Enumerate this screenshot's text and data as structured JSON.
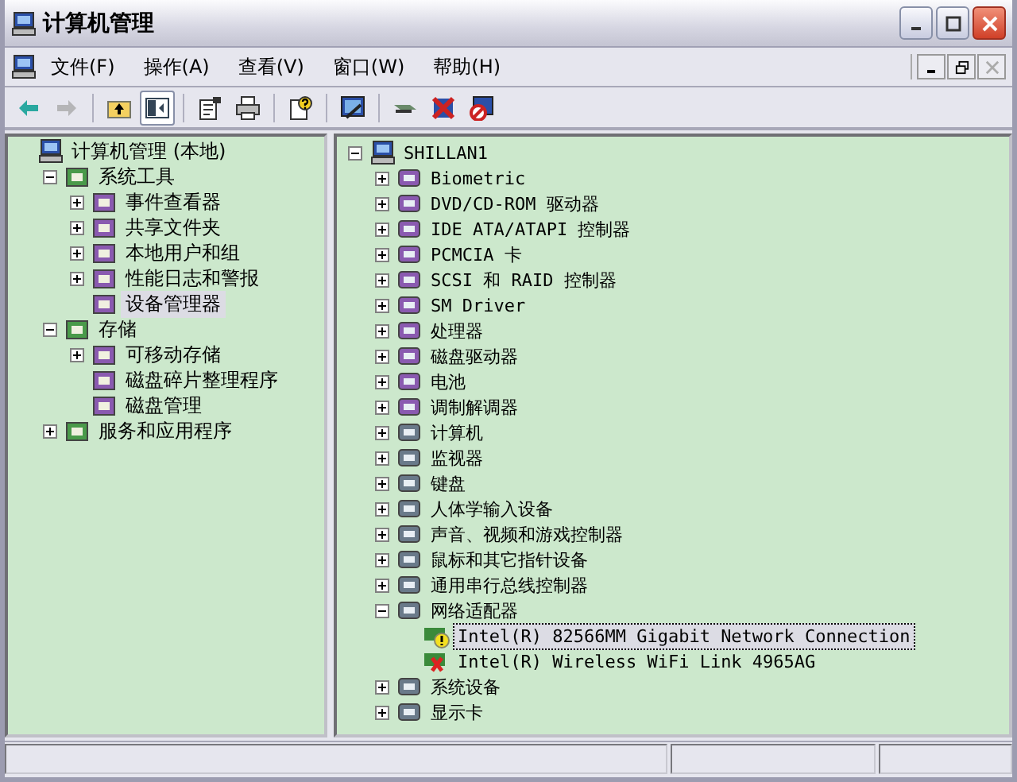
{
  "window": {
    "title": "计算机管理"
  },
  "menu": [
    "文件(F)",
    "操作(A)",
    "查看(V)",
    "窗口(W)",
    "帮助(H)"
  ],
  "toolbar": [
    {
      "kind": "back",
      "disabled": false,
      "pressed": false
    },
    {
      "kind": "forward",
      "disabled": true,
      "pressed": false
    },
    {
      "kind": "sep"
    },
    {
      "kind": "up",
      "disabled": false,
      "pressed": false
    },
    {
      "kind": "tree",
      "disabled": false,
      "pressed": true
    },
    {
      "kind": "sep"
    },
    {
      "kind": "properties",
      "disabled": false,
      "pressed": false
    },
    {
      "kind": "print",
      "disabled": false,
      "pressed": false
    },
    {
      "kind": "sep"
    },
    {
      "kind": "help",
      "disabled": false,
      "pressed": false
    },
    {
      "kind": "sep"
    },
    {
      "kind": "scan",
      "disabled": false,
      "pressed": false
    },
    {
      "kind": "sep"
    },
    {
      "kind": "update",
      "disabled": false,
      "pressed": false
    },
    {
      "kind": "uninstall",
      "disabled": false,
      "pressed": false
    },
    {
      "kind": "disable",
      "disabled": false,
      "pressed": false
    }
  ],
  "left_tree": [
    {
      "label": "计算机管理 (本地)",
      "selected": false,
      "children": [
        {
          "label": "系统工具",
          "has_expander": true,
          "expanded": true,
          "selected": false,
          "children": [
            {
              "label": "事件查看器",
              "has_expander": true,
              "expanded": false,
              "selected": false
            },
            {
              "label": "共享文件夹",
              "has_expander": true,
              "expanded": false,
              "selected": false
            },
            {
              "label": "本地用户和组",
              "has_expander": true,
              "expanded": false,
              "selected": false
            },
            {
              "label": "性能日志和警报",
              "has_expander": true,
              "expanded": false,
              "selected": false
            },
            {
              "label": "设备管理器",
              "has_expander": false,
              "expanded": false,
              "selected": true
            }
          ]
        },
        {
          "label": "存储",
          "has_expander": true,
          "expanded": true,
          "selected": false,
          "children": [
            {
              "label": "可移动存储",
              "has_expander": true,
              "expanded": false,
              "selected": false
            },
            {
              "label": "磁盘碎片整理程序",
              "has_expander": false,
              "expanded": false,
              "selected": false
            },
            {
              "label": "磁盘管理",
              "has_expander": false,
              "expanded": false,
              "selected": false
            }
          ]
        },
        {
          "label": "服务和应用程序",
          "has_expander": true,
          "expanded": false,
          "selected": false
        }
      ]
    }
  ],
  "right_tree": [
    {
      "label": "SHILLAN1",
      "has_expander": true,
      "expanded": true,
      "selected": false,
      "children": [
        {
          "label": "Biometric",
          "has_expander": true,
          "expanded": false,
          "selected": false
        },
        {
          "label": "DVD/CD-ROM 驱动器",
          "has_expander": true,
          "expanded": false,
          "selected": false
        },
        {
          "label": "IDE ATA/ATAPI 控制器",
          "has_expander": true,
          "expanded": false,
          "selected": false
        },
        {
          "label": "PCMCIA 卡",
          "has_expander": true,
          "expanded": false,
          "selected": false
        },
        {
          "label": "SCSI 和 RAID 控制器",
          "has_expander": true,
          "expanded": false,
          "selected": false
        },
        {
          "label": "SM Driver",
          "has_expander": true,
          "expanded": false,
          "selected": false
        },
        {
          "label": "处理器",
          "has_expander": true,
          "expanded": false,
          "selected": false
        },
        {
          "label": "磁盘驱动器",
          "has_expander": true,
          "expanded": false,
          "selected": false
        },
        {
          "label": "电池",
          "has_expander": true,
          "expanded": false,
          "selected": false
        },
        {
          "label": "调制解调器",
          "has_expander": true,
          "expanded": false,
          "selected": false
        },
        {
          "label": "计算机",
          "has_expander": true,
          "expanded": false,
          "selected": false
        },
        {
          "label": "监视器",
          "has_expander": true,
          "expanded": false,
          "selected": false
        },
        {
          "label": "键盘",
          "has_expander": true,
          "expanded": false,
          "selected": false
        },
        {
          "label": "人体学输入设备",
          "has_expander": true,
          "expanded": false,
          "selected": false
        },
        {
          "label": "声音、视频和游戏控制器",
          "has_expander": true,
          "expanded": false,
          "selected": false
        },
        {
          "label": "鼠标和其它指针设备",
          "has_expander": true,
          "expanded": false,
          "selected": false
        },
        {
          "label": "通用串行总线控制器",
          "has_expander": true,
          "expanded": false,
          "selected": false
        },
        {
          "label": "网络适配器",
          "has_expander": true,
          "expanded": true,
          "selected": false,
          "children": [
            {
              "label": "Intel(R) 82566MM Gigabit Network Connection",
              "has_expander": false,
              "expanded": false,
              "selected": true,
              "warning": true,
              "disabled": false
            },
            {
              "label": "Intel(R) Wireless WiFi Link 4965AG",
              "has_expander": false,
              "expanded": false,
              "selected": false,
              "warning": false,
              "disabled": true
            }
          ]
        },
        {
          "label": "系统设备",
          "has_expander": true,
          "expanded": false,
          "selected": false
        },
        {
          "label": "显示卡",
          "has_expander": true,
          "expanded": false,
          "selected": false
        }
      ]
    }
  ]
}
